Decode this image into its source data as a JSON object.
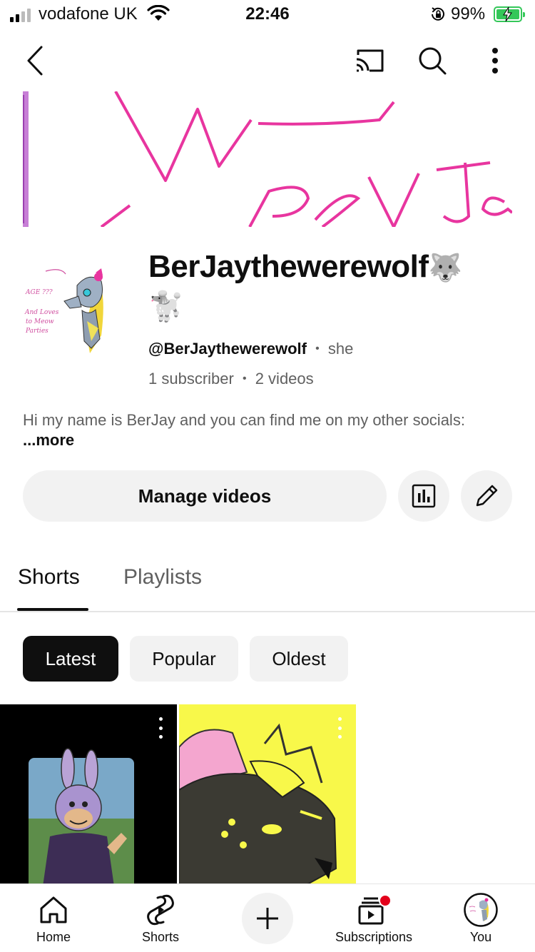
{
  "status_bar": {
    "carrier": "vodafone UK",
    "time": "22:46",
    "battery_percent": "99%",
    "battery_level": 0.99
  },
  "top_nav": {
    "icons": [
      "back-arrow-icon",
      "cast-icon",
      "search-icon",
      "more-vert-icon"
    ]
  },
  "channel": {
    "name": "BerJaythewerewolf",
    "name_emoji_1": "🐺",
    "name_emoji_2": "🐩",
    "handle": "@BerJaythewerewolf",
    "pronoun": "she",
    "subscribers": "1 subscriber",
    "videos": "2 videos",
    "separator": "•",
    "description": "Hi my name is BerJay and you can find me on my other socials:",
    "description_more": "...more"
  },
  "actions": {
    "manage_videos_label": "Manage videos"
  },
  "tabs": [
    {
      "label": "Shorts",
      "active": true
    },
    {
      "label": "Playlists",
      "active": false
    }
  ],
  "chips": [
    {
      "label": "Latest",
      "selected": true
    },
    {
      "label": "Popular",
      "selected": false
    },
    {
      "label": "Oldest",
      "selected": false
    }
  ],
  "bottom_nav": [
    {
      "label": "Home",
      "icon": "home-icon"
    },
    {
      "label": "Shorts",
      "icon": "shorts-icon"
    },
    {
      "label": "",
      "icon": "plus-icon"
    },
    {
      "label": "Subscriptions",
      "icon": "subscriptions-icon"
    },
    {
      "label": "You",
      "icon": "avatar"
    }
  ],
  "colors": {
    "banner_ink": "#e8359f",
    "shorts_bg_2": "#f8f84a",
    "notification_dot": "#e3001b",
    "battery": "#34c759"
  }
}
